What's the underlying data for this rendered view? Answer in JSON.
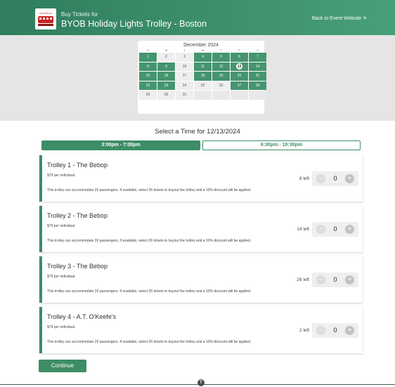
{
  "header": {
    "logo_text": "SUBURBAN",
    "buy_label": "Buy Tickets for",
    "event_title": "BYOB Holiday Lights Trolley - Boston",
    "back_label": "Back to Event Website ✕"
  },
  "calendar": {
    "month_label": "December 2024",
    "weekdays": [
      "S",
      "M",
      "T",
      "W",
      "T",
      "F",
      "S"
    ],
    "days": [
      {
        "d": "1",
        "s": "avail"
      },
      {
        "d": "2",
        "s": "unavail"
      },
      {
        "d": "3",
        "s": "unavail"
      },
      {
        "d": "4",
        "s": "avail"
      },
      {
        "d": "5",
        "s": "avail"
      },
      {
        "d": "6",
        "s": "avail"
      },
      {
        "d": "7",
        "s": "avail"
      },
      {
        "d": "8",
        "s": "avail"
      },
      {
        "d": "9",
        "s": "avail"
      },
      {
        "d": "10",
        "s": "unavail"
      },
      {
        "d": "11",
        "s": "avail"
      },
      {
        "d": "12",
        "s": "avail"
      },
      {
        "d": "13",
        "s": "selected"
      },
      {
        "d": "14",
        "s": "avail"
      },
      {
        "d": "15",
        "s": "avail"
      },
      {
        "d": "16",
        "s": "avail"
      },
      {
        "d": "17",
        "s": "unavail"
      },
      {
        "d": "18",
        "s": "avail"
      },
      {
        "d": "19",
        "s": "avail"
      },
      {
        "d": "20",
        "s": "avail"
      },
      {
        "d": "21",
        "s": "avail"
      },
      {
        "d": "22",
        "s": "avail"
      },
      {
        "d": "23",
        "s": "avail"
      },
      {
        "d": "24",
        "s": "unavail"
      },
      {
        "d": "25",
        "s": "unavail"
      },
      {
        "d": "26",
        "s": "unavail"
      },
      {
        "d": "27",
        "s": "avail"
      },
      {
        "d": "28",
        "s": "avail"
      },
      {
        "d": "29",
        "s": "unavail"
      },
      {
        "d": "30",
        "s": "unavail"
      },
      {
        "d": "31",
        "s": "unavail"
      },
      {
        "d": "",
        "s": "empty"
      },
      {
        "d": "",
        "s": "empty"
      },
      {
        "d": "",
        "s": "empty"
      },
      {
        "d": "",
        "s": "empty"
      }
    ]
  },
  "select_time_label": "Select a Time for 12/13/2024",
  "time_tabs": [
    {
      "label": "3:00pm - 7:00pm",
      "active": true
    },
    {
      "label": "6:30pm - 10:30pm",
      "active": false
    }
  ],
  "trolleys": [
    {
      "title": "Trolley 1 - The Bebop",
      "price": "$79 per individual.",
      "desc": "This trolley can accommodate 26 passengers. If available, select 26 tickets to buyout the trolley and a 10% discount will be applied.",
      "left": "8 left",
      "qty": "0"
    },
    {
      "title": "Trolley 2 - The Bebop",
      "price": "$79 per individual.",
      "desc": "This trolley can accommodate 26 passengers. If available, select 26 tickets to buyout the trolley and a 10% discount will be applied.",
      "left": "14 left",
      "qty": "0"
    },
    {
      "title": "Trolley 3 - The Bebop",
      "price": "$79 per individual.",
      "desc": "This trolley can accommodate 26 passengers. If available, select 26 tickets to buyout the trolley and a 10% discount will be applied.",
      "left": "26 left",
      "qty": "0"
    },
    {
      "title": "Trolley 4 - A.T. O'Keefe's",
      "price": "$79 per individual.",
      "desc": "This trolley can accommodate 26 passengers. If available, select 26 tickets to buyout the trolley and a 10% discount will be applied.",
      "left": "2 left",
      "qty": "0"
    }
  ],
  "stepper": {
    "minus": "−",
    "plus": "+"
  },
  "continue_label": "Continue",
  "colors": {
    "accent": "#3d8d66",
    "calendar_available": "#45956f"
  }
}
